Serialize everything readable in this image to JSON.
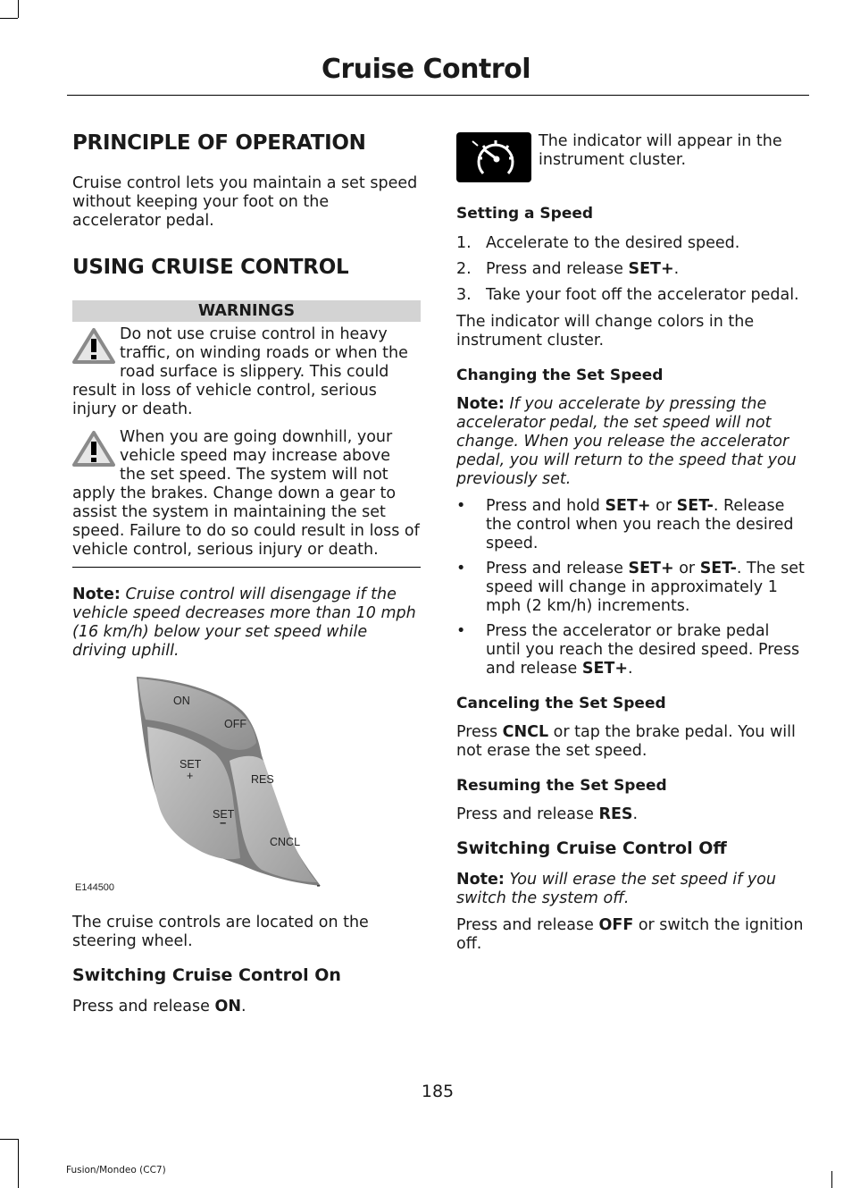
{
  "header": {
    "title": "Cruise Control"
  },
  "left": {
    "principle_heading": "PRINCIPLE OF OPERATION",
    "principle_text": "Cruise control lets you maintain a set speed without keeping your foot on the accelerator pedal.",
    "using_heading": "USING CRUISE CONTROL",
    "warnings_label": "WARNINGS",
    "warnings": [
      "Do not use cruise control in heavy traffic, on winding roads or when the road surface is slippery. This could result in loss of vehicle control, serious injury or death.",
      "When you are going downhill, your vehicle speed may increase above the set speed. The system will not apply the brakes. Change down a gear to assist the system in maintaining the set speed. Failure to do so could result in loss of vehicle control, serious injury or death."
    ],
    "note_label": "Note:",
    "note_text": "Cruise control will disengage if the vehicle speed decreases more than 10 mph (16 km/h) below your set speed while driving uphill.",
    "figure": {
      "labels": {
        "on": "ON",
        "off": "OFF",
        "set_plus": "SET",
        "plus": "+",
        "res": "RES",
        "set_minus": "SET",
        "minus": "−",
        "cncl": "CNCL"
      },
      "code": "E144500"
    },
    "location_text": "The cruise controls are located on the steering wheel.",
    "switch_on_heading": "Switching Cruise Control On",
    "switch_on_pre": "Press and release ",
    "switch_on_bold": "ON",
    "switch_on_post": "."
  },
  "right": {
    "indicator_icon": "cruise-speedometer-icon",
    "indicator_text": "The indicator will appear in the instrument cluster.",
    "setting_heading": "Setting a Speed",
    "setting_steps": [
      {
        "num": "1.",
        "pre": "Accelerate to the desired speed.",
        "bold": "",
        "post": ""
      },
      {
        "num": "2.",
        "pre": "Press and release ",
        "bold": "SET+",
        "post": "."
      },
      {
        "num": "3.",
        "pre": "Take your foot off the accelerator pedal.",
        "bold": "",
        "post": ""
      }
    ],
    "indicator_change_text": "The indicator will change colors in the instrument cluster.",
    "changing_heading": "Changing the Set Speed",
    "changing_note_label": "Note:",
    "changing_note_text": "If you accelerate by pressing the accelerator pedal, the set speed will not change. When you release the accelerator pedal, you will return to the speed that you previously set.",
    "changing_bullets": [
      {
        "a": "Press and hold ",
        "b1": "SET+",
        "c": " or ",
        "b2": "SET-",
        "d": ". Release the control when you reach the desired speed."
      },
      {
        "a": "Press and release ",
        "b1": "SET+",
        "c": " or ",
        "b2": "SET-",
        "d": ". The set speed will change in approximately 1 mph (2 km/h) increments."
      },
      {
        "a": "Press the accelerator or brake pedal until you reach the desired speed. Press and release ",
        "b1": "SET+",
        "c": ".",
        "b2": "",
        "d": ""
      }
    ],
    "bullet_char": "•",
    "canceling_heading": "Canceling the Set Speed",
    "canceling_pre": "Press ",
    "canceling_bold": "CNCL",
    "canceling_post": " or tap the brake pedal. You will not erase the set speed.",
    "resuming_heading": "Resuming the Set Speed",
    "resuming_pre": "Press and release ",
    "resuming_bold": "RES",
    "resuming_post": ".",
    "switch_off_heading": "Switching Cruise Control Off",
    "switch_off_note_label": "Note:",
    "switch_off_note_text": "You will erase the set speed if you switch the system off.",
    "switch_off_pre": "Press and release ",
    "switch_off_bold": "OFF",
    "switch_off_post": " or switch the ignition off."
  },
  "footer": {
    "page_number": "185",
    "model": "Fusion/Mondeo (CC7)"
  }
}
